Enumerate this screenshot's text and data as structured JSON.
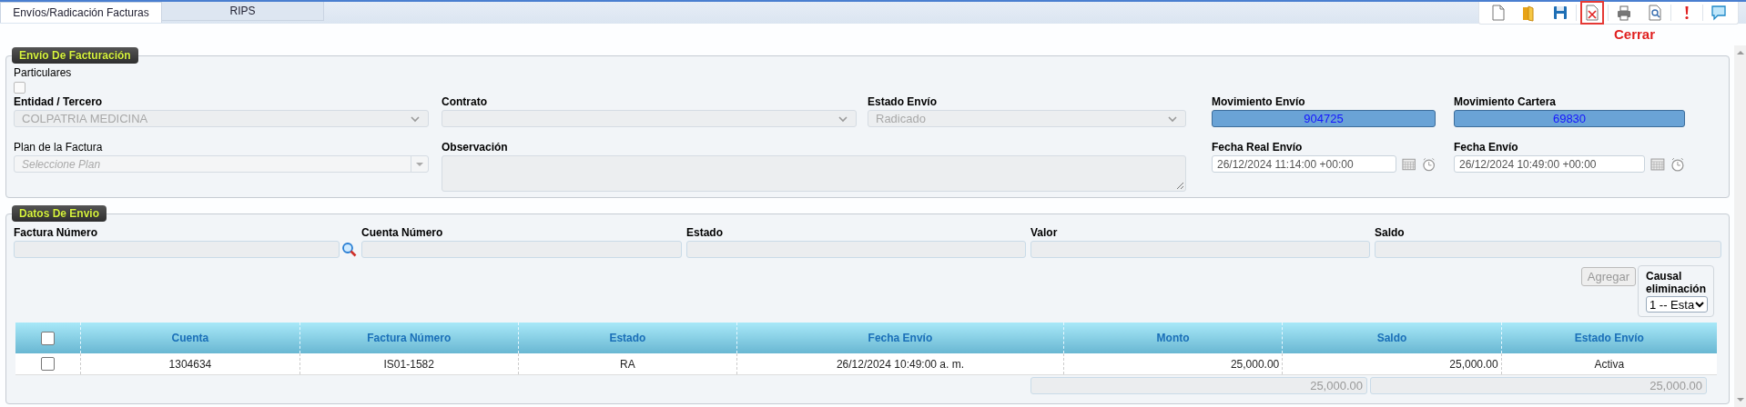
{
  "tabs": [
    {
      "label": "Envíos/Radicación Facturas",
      "selected": true
    },
    {
      "label": "RIPS",
      "selected": false
    }
  ],
  "toolbar": {
    "buttons": [
      {
        "highlighted": false
      },
      {
        "highlighted": false
      },
      {
        "highlighted": false
      },
      {
        "highlighted": true
      },
      {
        "highlighted": false
      },
      {
        "highlighted": false
      },
      {
        "highlighted": false
      },
      {
        "highlighted": false
      }
    ],
    "hint": "Cerrar"
  },
  "envio": {
    "legend": "Envío De Facturación",
    "particulares": {
      "label": "Particulares",
      "checked": false
    },
    "fields": [
      {
        "label": "Entidad / Tercero",
        "kind": "select",
        "value": "COLPATRIA MEDICINA"
      },
      {
        "label": "Contrato",
        "kind": "select"
      },
      {
        "label": "Estado Envío",
        "kind": "select",
        "value": "Radicado"
      },
      {
        "label": "Movimiento Envío",
        "kind": "readonly",
        "value": "904725"
      },
      {
        "label": "Movimiento Cartera",
        "kind": "readonly",
        "value": "69830"
      },
      {
        "label": "Plan de la Factura",
        "kind": "combo",
        "placeholder": "Seleccione Plan"
      },
      {
        "label": "Observación",
        "kind": "textarea"
      },
      {
        "label": "Fecha Real Envío",
        "kind": "datetime",
        "value": "26/12/2024 11:14:00 +00:00"
      },
      {
        "label": "Fecha Envío",
        "kind": "datetime",
        "value": "26/12/2024 10:49:00 +00:00"
      }
    ]
  },
  "datos": {
    "legend": "Datos De Envio",
    "fields": [
      {
        "label": "Factura Número",
        "search": true
      },
      {
        "label": "Cuenta Número",
        "search": false
      },
      {
        "label": "Estado",
        "search": false
      },
      {
        "label": "Valor",
        "search": false
      },
      {
        "label": "Saldo",
        "search": false
      }
    ],
    "agregar": {
      "label": "Agregar",
      "disabled": true
    },
    "causal": {
      "label": "Causal eliminación",
      "value": "1 -- Esta"
    }
  },
  "table": {
    "header_checked": false,
    "columns": [
      "Cuenta",
      "Factura Número",
      "Estado",
      "Fecha Envío",
      "Monto",
      "Saldo",
      "Estado Envío"
    ],
    "rows": [
      {
        "checked": false,
        "cells": [
          "1304634",
          "IS01-1582",
          "RA",
          "26/12/2024 10:49:00 a. m.",
          "25,000.00",
          "25,000.00",
          "Activa"
        ]
      }
    ],
    "totals": [
      "25,000.00",
      "25,000.00"
    ]
  }
}
